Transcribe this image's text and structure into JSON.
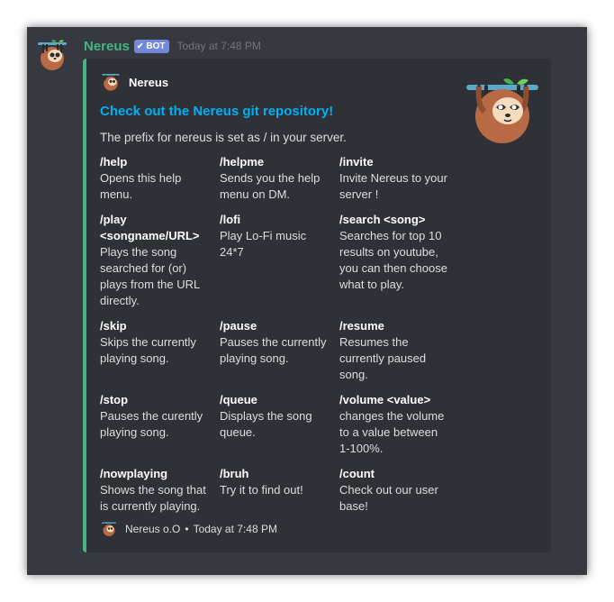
{
  "message": {
    "username": "Nereus",
    "bot_label": "BOT",
    "bot_check": "✔",
    "timestamp": "Today at 7:48 PM"
  },
  "embed": {
    "author_name": "Nereus",
    "title": "Check out the Nereus git repository!",
    "description": "The prefix for nereus is set as / in your server.",
    "fields": [
      {
        "name": "/help",
        "value": "Opens this help menu."
      },
      {
        "name": "/helpme",
        "value": "Sends you the help menu on DM."
      },
      {
        "name": "/invite",
        "value": "Invite Nereus to your server !"
      },
      {
        "name": "/play <songname/URL>",
        "value": "Plays the song searched for (or) plays from the URL directly."
      },
      {
        "name": "/lofi",
        "value": "Play Lo-Fi music 24*7"
      },
      {
        "name": "/search <song>",
        "value": "Searches for top 10 results on youtube, you can then choose what to play."
      },
      {
        "name": "/skip",
        "value": "Skips the currently playing song."
      },
      {
        "name": "/pause",
        "value": "Pauses the currently playing song."
      },
      {
        "name": "/resume",
        "value": "Resumes the currently paused song."
      },
      {
        "name": "/stop",
        "value": "Pauses the curently playing song."
      },
      {
        "name": "/queue",
        "value": "Displays the song queue."
      },
      {
        "name": "/volume <value>",
        "value": "changes the volume to a value between 1-100%."
      },
      {
        "name": "/nowplaying",
        "value": "Shows the song that is currently playing."
      },
      {
        "name": "/bruh",
        "value": "Try it to find out!"
      },
      {
        "name": "/count",
        "value": "Check out our user base!"
      }
    ],
    "footer_text": "Nereus o.O",
    "footer_separator": "•",
    "footer_time": "Today at 7:48 PM"
  },
  "colors": {
    "background": "#36393f",
    "embed_background": "#2f3136",
    "embed_accent": "#43b581",
    "link": "#00b0f4",
    "bot_badge": "#7289da"
  }
}
